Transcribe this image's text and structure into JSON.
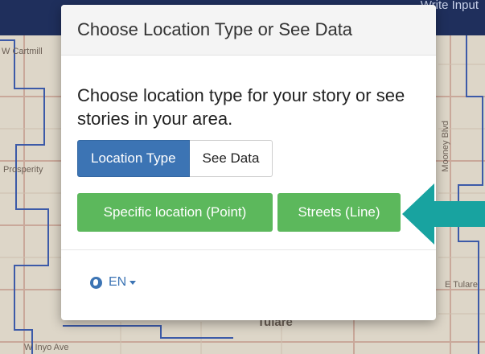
{
  "map": {
    "labels": {
      "cartmill": "W Cartmill",
      "prosperity": "Prosperity",
      "mooney": "Mooney Blvd",
      "tulare_ave": "E Tulare",
      "city": "Tulare",
      "inyo": "W Inyo Ave"
    },
    "topbar_text": "Write Input"
  },
  "modal": {
    "title": "Choose Location Type or See Data",
    "prompt": "Choose location type for your story or see stories in your area.",
    "tabs": [
      {
        "label": "Location Type",
        "active": true
      },
      {
        "label": "See Data",
        "active": false
      }
    ],
    "choices": [
      {
        "label": "Specific location (Point)"
      },
      {
        "label": "Streets (Line)"
      }
    ],
    "language": {
      "label": "EN",
      "icon": "globe-icon"
    }
  },
  "colors": {
    "primary": "#3c74b4",
    "success": "#5cb85c",
    "arrow": "#18a3a0",
    "topbar": "#1f2f5c"
  }
}
